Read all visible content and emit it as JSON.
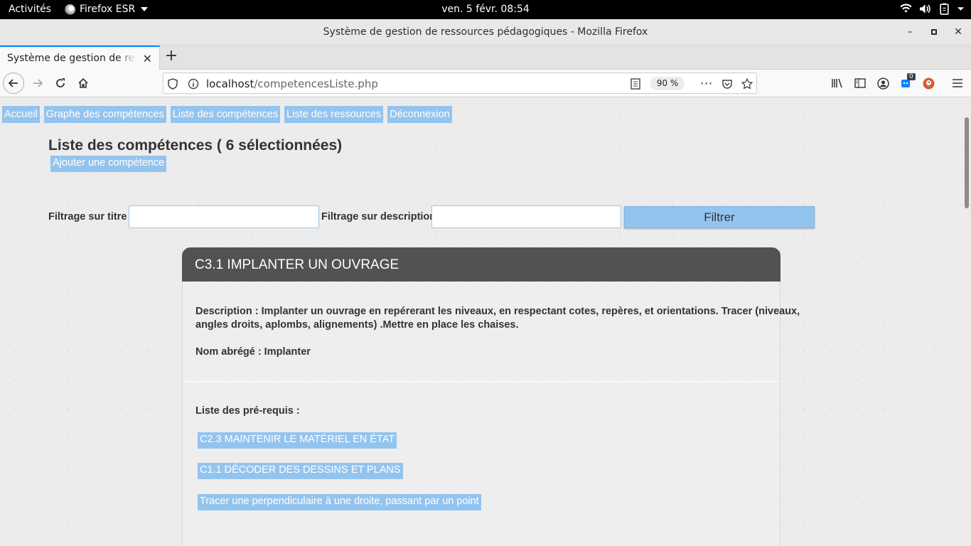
{
  "system": {
    "activities": "Activités",
    "app_name": "Firefox ESR",
    "clock": "ven. 5 févr.  08:54"
  },
  "window": {
    "title": "Système de gestion de ressources pédagogiques - Mozilla Firefox"
  },
  "tabs": [
    {
      "title": "Système de gestion de ressources pédagogiques"
    }
  ],
  "navbar": {
    "url_host": "localhost",
    "url_path": "/competencesListe.php",
    "zoom": "90 %",
    "notification_count": "0"
  },
  "page": {
    "menu": [
      "Accueil",
      "Graphe des compétences",
      "Liste des compétences",
      "Liste des ressources",
      "Déconnexion"
    ],
    "title": "Liste des compétences ( 6 sélectionnées)",
    "add_button": "Ajouter une compétence",
    "filter": {
      "title_label": "Filtrage sur titre :",
      "title_value": "",
      "description_label": "Filtrage sur description :",
      "description_value": "",
      "button": "Filtrer"
    },
    "competence": {
      "header": "C3.1 IMPLANTER UN OUVRAGE",
      "description_line1": "Description : Implanter un ouvrage en repérerant les niveaux, en respectant cotes, repères, et orientations. Tracer (niveaux,",
      "description_line2": "angles droits, aplombs, alignements) .Mettre en place les chaises.",
      "short_name": "Nom abrégé : Implanter",
      "prereq_label": "Liste des pré-requis :",
      "prerequisites": [
        "C2.3 MAINTENIR LE MATÉRIEL EN ÉTAT",
        "C1.1 DÉCODER DES DESSINS ET PLANS",
        "Tracer une perpendiculaire à une droite, passant par un point"
      ]
    }
  }
}
